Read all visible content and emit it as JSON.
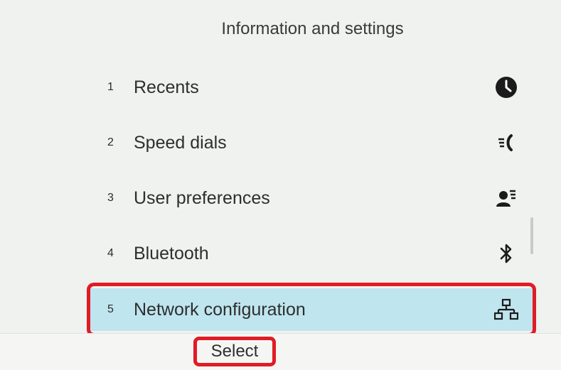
{
  "header": {
    "title": "Information and settings"
  },
  "menu": {
    "items": [
      {
        "number": "1",
        "label": "Recents",
        "icon": "clock-icon"
      },
      {
        "number": "2",
        "label": "Speed dials",
        "icon": "speed-dial-icon"
      },
      {
        "number": "3",
        "label": "User preferences",
        "icon": "user-preferences-icon"
      },
      {
        "number": "4",
        "label": "Bluetooth",
        "icon": "bluetooth-icon"
      },
      {
        "number": "5",
        "label": "Network configuration",
        "icon": "network-icon",
        "selected": true
      }
    ]
  },
  "softkeys": {
    "select_label": "Select"
  },
  "colors": {
    "highlight_background": "#bfe5ef",
    "annotation_red": "#e11b24",
    "screen_background": "#f0f2ef"
  }
}
